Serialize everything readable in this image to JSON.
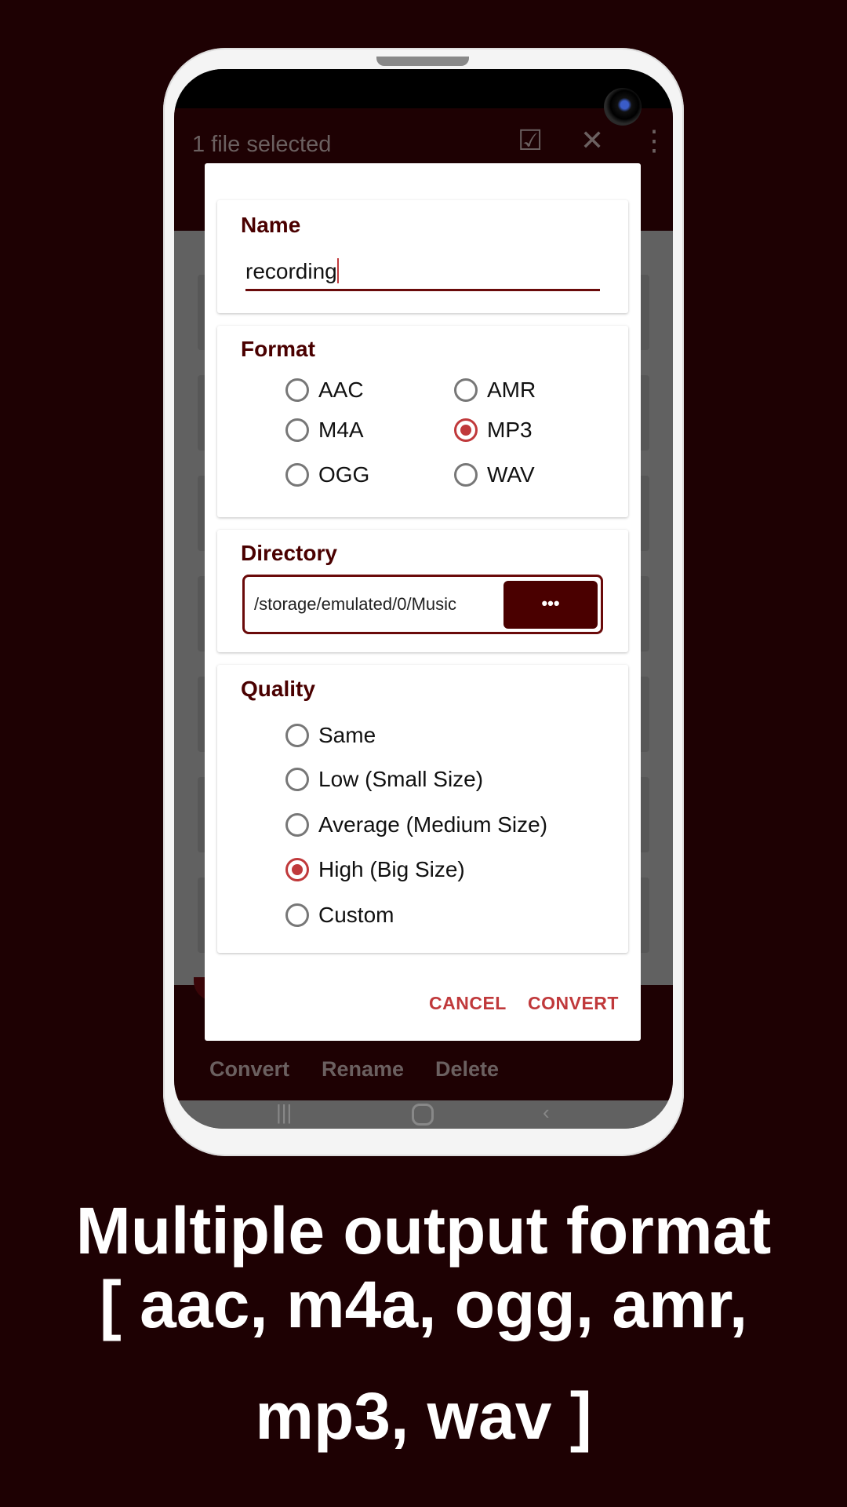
{
  "app_bar": {
    "title": "1 file selected",
    "icons": [
      "select-all-icon",
      "close-icon",
      "more-vert-icon"
    ]
  },
  "bottom_bar": {
    "items": [
      {
        "label": "Convert"
      },
      {
        "label": "Rename"
      },
      {
        "label": "Delete"
      }
    ]
  },
  "dialog": {
    "name": {
      "title": "Name",
      "value": "recording"
    },
    "format": {
      "title": "Format",
      "options": [
        "AAC",
        "AMR",
        "M4A",
        "MP3",
        "OGG",
        "WAV"
      ],
      "selected": "MP3"
    },
    "directory": {
      "title": "Directory",
      "path": "/storage/emulated/0/Music",
      "browse_label": "•••"
    },
    "quality": {
      "title": "Quality",
      "options": [
        "Same",
        "Low (Small Size)",
        "Average (Medium Size)",
        "High (Big Size)",
        "Custom"
      ],
      "selected": "High (Big Size)"
    },
    "cancel_label": "CANCEL",
    "convert_label": "CONVERT"
  },
  "caption": {
    "line1": "Multiple output format",
    "line2": "[ aac, m4a, ogg, amr,",
    "line3": "mp3, wav ]"
  },
  "colors": {
    "background": "#1e0103",
    "title": "#4a0000",
    "accent": "#c0393b"
  }
}
